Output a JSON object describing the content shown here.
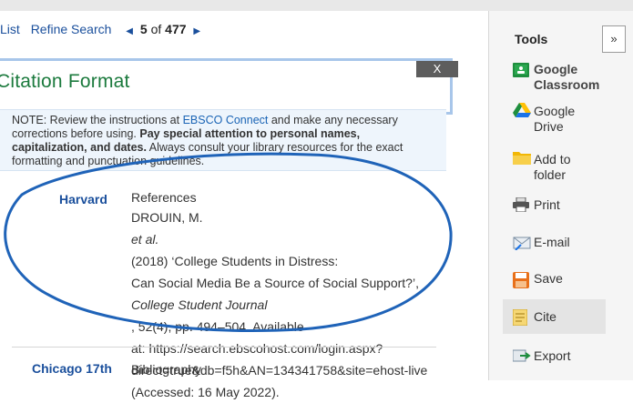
{
  "nav": {
    "list_label": "List",
    "refine_label": "Refine Search",
    "prev_arrow": "◀",
    "current": "5",
    "of_label": "of",
    "total": "477",
    "next_arrow": "▶"
  },
  "dialog": {
    "title": "Citation Format",
    "close_label": "X"
  },
  "note": {
    "line1_pre": "NOTE: Review the instructions at ",
    "link": "EBSCO Connect",
    "line1_post": " and make any necessary",
    "line2_pre": "corrections before using. ",
    "line2_bold": "Pay special attention to personal names,",
    "line3_bold": "capitalization, and dates.",
    "line3_post": " Always consult your library resources for the exact",
    "line4": "formatting and punctuation guidelines."
  },
  "citations": [
    {
      "style": "Harvard",
      "heading": "References",
      "line1_a": "DROUIN, M. ",
      "line1_b": "et al.",
      "line1_c": " (2018) ‘College Students in Distress:",
      "line2": "Can Social Media Be a Source of Social Support?’,",
      "line3_a": "College Student Journal",
      "line3_b": ", 52(4), pp. 494–504. Available",
      "line4": "at: https://search.ebscohost.com/login.aspx?",
      "line5": "direct=true&db=f5h&AN=134341758&site=ehost-live",
      "line6": "(Accessed: 16 May 2022)."
    },
    {
      "style": "Chicago 17th",
      "heading": "Bibliography"
    }
  ],
  "tools": {
    "title": "Tools",
    "collapse_label": "»",
    "items": [
      {
        "label_1": "Google",
        "label_2": "Classroom",
        "icon": "google-classroom-icon"
      },
      {
        "label_1": "Google",
        "label_2": "Drive",
        "icon": "google-drive-icon"
      },
      {
        "label_1": "Add to",
        "label_2": "folder",
        "icon": "folder-icon"
      },
      {
        "label_1": "Print",
        "icon": "printer-icon"
      },
      {
        "label_1": "E-mail",
        "icon": "email-icon"
      },
      {
        "label_1": "Save",
        "icon": "save-icon"
      },
      {
        "label_1": "Cite",
        "icon": "cite-icon"
      },
      {
        "label_1": "Export",
        "icon": "export-icon"
      }
    ]
  },
  "colors": {
    "link": "#1a4f9c",
    "title_green": "#1b7a3d",
    "annotation_oval": "#1f63b8"
  }
}
